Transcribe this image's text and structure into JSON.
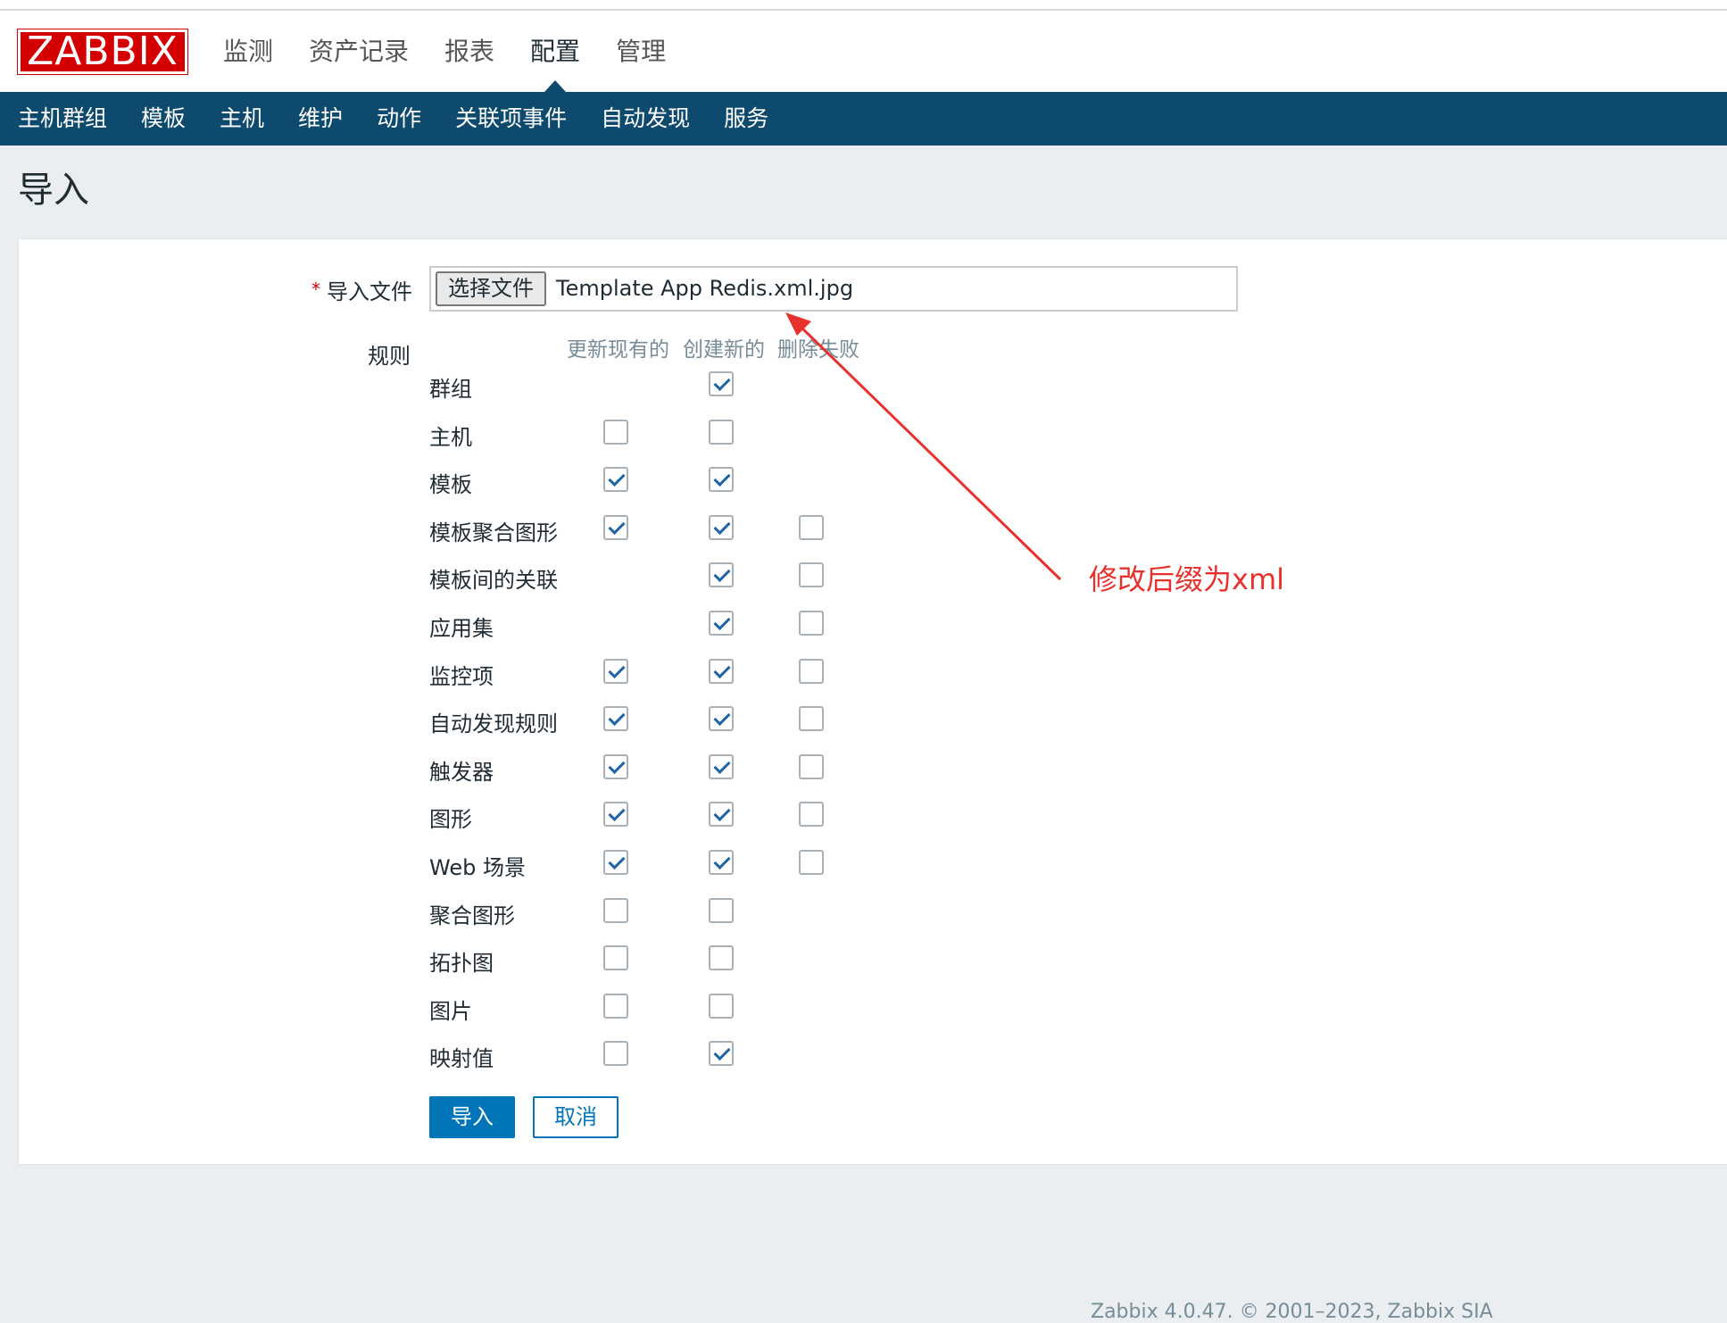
{
  "logo": "ZABBIX",
  "main_nav": [
    "监测",
    "资产记录",
    "报表",
    "配置",
    "管理"
  ],
  "sub_nav": [
    "主机群组",
    "模板",
    "主机",
    "维护",
    "动作",
    "关联项事件",
    "自动发现",
    "服务"
  ],
  "page_title": "导入",
  "form": {
    "file_label": "导入文件",
    "required_mark": "*",
    "choose_file_button": "选择文件",
    "file_name": "Template App Redis.xml.jpg",
    "rules_label": "规则",
    "columns": [
      "更新现有的",
      "创建新的",
      "删除失败"
    ],
    "rules": [
      {
        "label": "群组",
        "update": null,
        "create": true,
        "delete": null
      },
      {
        "label": "主机",
        "update": false,
        "create": false,
        "delete": null
      },
      {
        "label": "模板",
        "update": true,
        "create": true,
        "delete": null
      },
      {
        "label": "模板聚合图形",
        "update": true,
        "create": true,
        "delete": false
      },
      {
        "label": "模板间的关联",
        "update": null,
        "create": true,
        "delete": false
      },
      {
        "label": "应用集",
        "update": null,
        "create": true,
        "delete": false
      },
      {
        "label": "监控项",
        "update": true,
        "create": true,
        "delete": false
      },
      {
        "label": "自动发现规则",
        "update": true,
        "create": true,
        "delete": false
      },
      {
        "label": "触发器",
        "update": true,
        "create": true,
        "delete": false
      },
      {
        "label": "图形",
        "update": true,
        "create": true,
        "delete": false
      },
      {
        "label": "Web 场景",
        "update": true,
        "create": true,
        "delete": false
      },
      {
        "label": "聚合图形",
        "update": false,
        "create": false,
        "delete": null
      },
      {
        "label": "拓扑图",
        "update": false,
        "create": false,
        "delete": null
      },
      {
        "label": "图片",
        "update": false,
        "create": false,
        "delete": null
      },
      {
        "label": "映射值",
        "update": false,
        "create": true,
        "delete": null
      }
    ],
    "import_button": "导入",
    "cancel_button": "取消"
  },
  "annotation": "修改后缀为xml",
  "footer": "Zabbix 4.0.47. © 2001–2023, Zabbix SIA",
  "colors": {
    "nav_bg": "#0e4a6d",
    "logo_bg": "#d40000",
    "primary": "#0275b8",
    "annotation": "#e8312c"
  }
}
